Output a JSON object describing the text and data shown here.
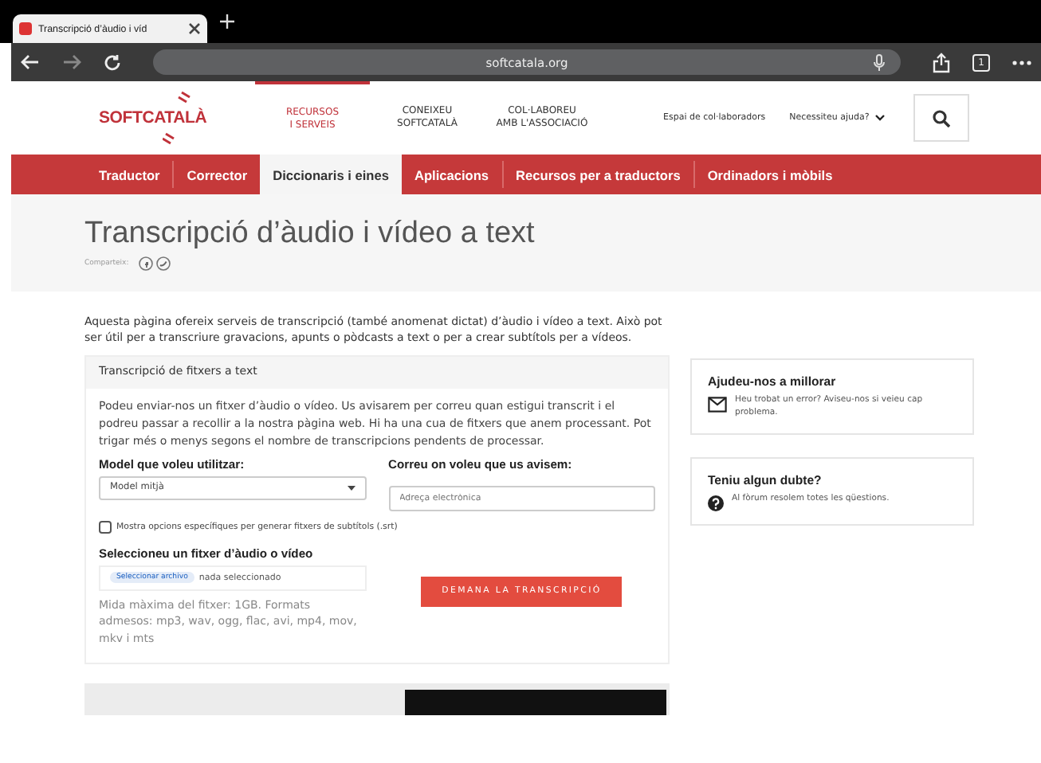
{
  "browser": {
    "tab_title": "Transcripció d’àudio i víd",
    "url": "softcatala.org",
    "tab_count": "1"
  },
  "header": {
    "logo": "SOFTCATALÀ",
    "menu": [
      {
        "label": "RECURSOS\nI SERVEIS",
        "selected": true
      },
      {
        "label": "CONEIXEU\nSOFTCATALÀ",
        "selected": false
      },
      {
        "label": "COL·LABOREU\nAMB L'ASSOCIACIÓ",
        "selected": false
      }
    ],
    "links": [
      "Espai de col·laboradors",
      "Necessiteu ajuda?"
    ]
  },
  "nav": [
    {
      "label": "Traductor",
      "selected": false
    },
    {
      "label": "Corrector",
      "selected": false
    },
    {
      "label": "Diccionaris i eines",
      "selected": true
    },
    {
      "label": "Aplicacions",
      "selected": false
    },
    {
      "label": "Recursos per a traductors",
      "selected": false
    },
    {
      "label": "Ordinadors i mòbils",
      "selected": false
    }
  ],
  "page": {
    "title": "Transcripció d’àudio i vídeo a text",
    "share_label": "Comparteix:",
    "intro": "Aquesta pàgina ofereix serveis de transcripció (també anomenat dictat) d’àudio i vídeo a text. Això pot ser útil per a transcriure gravacions, apunts o pòdcasts a text o per a crear subtítols per a vídeos."
  },
  "card": {
    "heading": "Transcripció de fitxers a text",
    "description": "Podeu enviar-nos un fitxer d’àudio o vídeo. Us avisarem per correu quan estigui transcrit i el podreu passar a recollir a la nostra pàgina web. Hi ha una cua de fitxers que anem processant. Pot trigar més o menys segons el nombre de transcripcions pendents de processar.",
    "model_label": "Model que voleu utilitzar:",
    "model_value": "Model mitjà",
    "email_label": "Correu on voleu que us avisem:",
    "email_placeholder": "Adreça electrònica",
    "checkbox": {
      "label": "Mostra opcions específiques per generar fitxers de subtítols (.srt)",
      "checked": false
    },
    "file_label": "Seleccioneu un fitxer d’àudio o vídeo",
    "file_button": "Seleccionar archivo",
    "file_status": "nada seleccionado",
    "hint": "Mida màxima del fitxer: 1GB. Formats admesos: mp3, wav, ogg, flac, avi, mp4, mov, mkv i mts",
    "submit": "DEMANA LA TRANSCRIPCIÓ"
  },
  "sidebar": [
    {
      "kind": "mail",
      "title": "Ajudeu-nos a millorar",
      "text": "Heu trobat un error? Aviseu-nos si veieu cap problema."
    },
    {
      "kind": "help",
      "title": "Teniu algun dubte?",
      "text": "Al fòrum resolem totes les qüestions."
    }
  ]
}
